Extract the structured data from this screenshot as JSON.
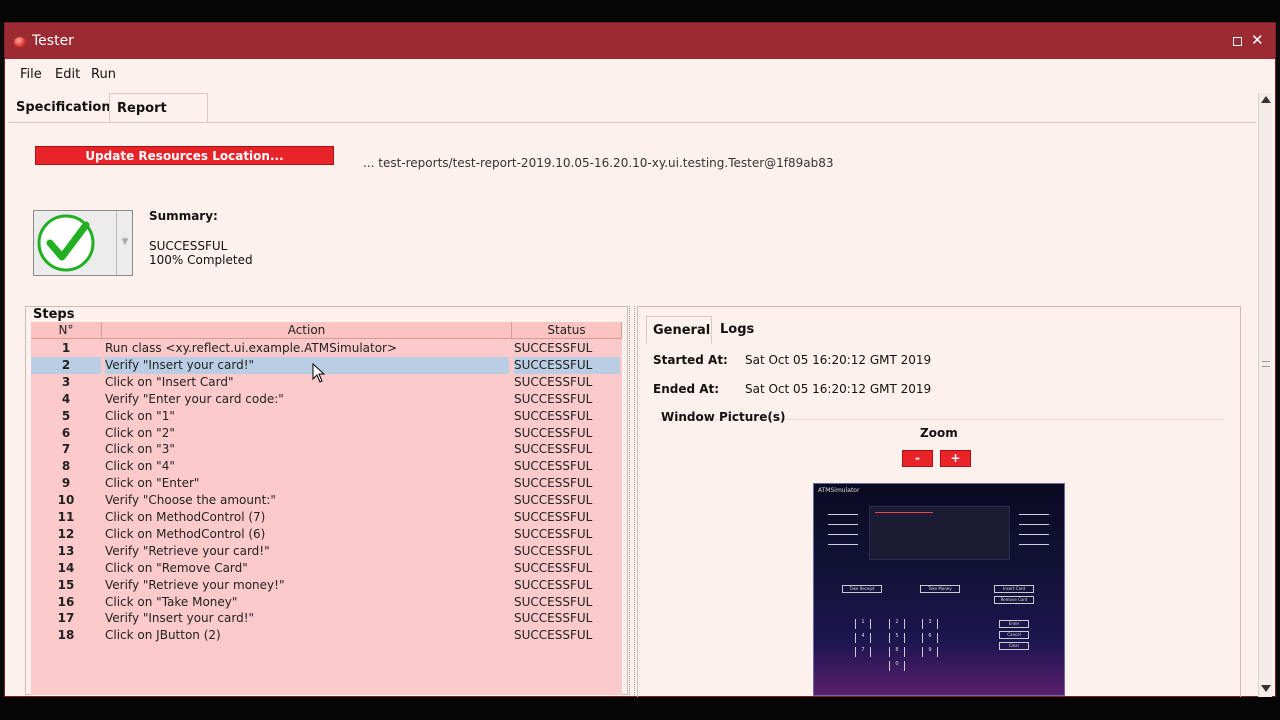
{
  "window": {
    "title": "Tester"
  },
  "menu": [
    "File",
    "Edit",
    "Run"
  ],
  "top_tabs": {
    "specification": "Specification",
    "report": "Report"
  },
  "report": {
    "update_button": "Update Resources Location...",
    "path": "... test-reports/test-report-2019.10.05-16.20.10-xy.ui.testing.Tester@1f89ab83",
    "summary_label": "Summary:",
    "summary_status": "SUCCESSFUL",
    "summary_progress": "100% Completed"
  },
  "steps": {
    "title": "Steps",
    "columns": [
      "N°",
      "Action",
      "Status"
    ],
    "rows": [
      {
        "n": "1",
        "action": "Run class <xy.reflect.ui.example.ATMSimulator>",
        "status": "SUCCESSFUL"
      },
      {
        "n": "2",
        "action": "Verify \"Insert your card!\"",
        "status": "SUCCESSFUL",
        "selected": true
      },
      {
        "n": "3",
        "action": "Click on \"Insert Card\"",
        "status": "SUCCESSFUL"
      },
      {
        "n": "4",
        "action": "Verify \"Enter your card code:\"",
        "status": "SUCCESSFUL"
      },
      {
        "n": "5",
        "action": "Click on \"1\"",
        "status": "SUCCESSFUL"
      },
      {
        "n": "6",
        "action": "Click on \"2\"",
        "status": "SUCCESSFUL"
      },
      {
        "n": "7",
        "action": "Click on \"3\"",
        "status": "SUCCESSFUL"
      },
      {
        "n": "8",
        "action": "Click on \"4\"",
        "status": "SUCCESSFUL"
      },
      {
        "n": "9",
        "action": "Click on \"Enter\"",
        "status": "SUCCESSFUL"
      },
      {
        "n": "10",
        "action": "Verify \"Choose the amount:\"",
        "status": "SUCCESSFUL"
      },
      {
        "n": "11",
        "action": "Click on MethodControl (7)",
        "status": "SUCCESSFUL"
      },
      {
        "n": "12",
        "action": "Click on MethodControl (6)",
        "status": "SUCCESSFUL"
      },
      {
        "n": "13",
        "action": "Verify \"Retrieve your card!\"",
        "status": "SUCCESSFUL"
      },
      {
        "n": "14",
        "action": "Click on \"Remove Card\"",
        "status": "SUCCESSFUL"
      },
      {
        "n": "15",
        "action": "Verify \"Retrieve your money!\"",
        "status": "SUCCESSFUL"
      },
      {
        "n": "16",
        "action": "Click on \"Take Money\"",
        "status": "SUCCESSFUL"
      },
      {
        "n": "17",
        "action": "Verify \"Insert your card!\"",
        "status": "SUCCESSFUL"
      },
      {
        "n": "18",
        "action": "Click on JButton (2)",
        "status": "SUCCESSFUL"
      }
    ]
  },
  "details": {
    "tabs": {
      "general": "General",
      "logs": "Logs"
    },
    "started_label": "Started At:",
    "started_value": "Sat Oct 05 16:20:12 GMT 2019",
    "ended_label": "Ended At:",
    "ended_value": "Sat Oct 05 16:20:12 GMT 2019",
    "pictures_label": "Window Picture(s)",
    "zoom_label": "Zoom",
    "zoom_out": "-",
    "zoom_in": "+"
  },
  "atm_picture": {
    "title": "ATMSimulator",
    "keys": [
      "1",
      "2",
      "3",
      "4",
      "5",
      "6",
      "7",
      "8",
      "9",
      "0"
    ],
    "commands": [
      "Enter",
      "Cancel",
      "Clear"
    ],
    "buttons": [
      "Take Receipt",
      "Take Money",
      "Insert Card",
      "Remove Card"
    ]
  },
  "colors": {
    "titlebar": "#9b2a33",
    "accent_button": "#e8242a",
    "table_bg": "#fccaca",
    "selected_row": "#b9cde4",
    "success_check": "#22b022"
  }
}
